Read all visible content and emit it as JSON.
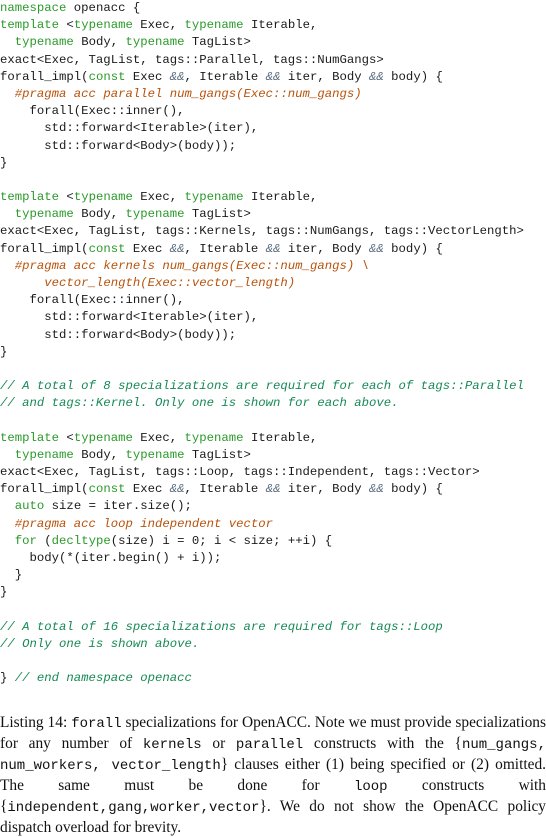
{
  "listing": {
    "lines": [
      [
        [
          "kw",
          "namespace"
        ],
        [
          "tx",
          " openacc {"
        ]
      ],
      [
        [
          "kw",
          "template"
        ],
        [
          "tx",
          " <"
        ],
        [
          "kw",
          "typename"
        ],
        [
          "tx",
          " Exec, "
        ],
        [
          "kw",
          "typename"
        ],
        [
          "tx",
          " Iterable,"
        ]
      ],
      [
        [
          "tx",
          "  "
        ],
        [
          "kw",
          "typename"
        ],
        [
          "tx",
          " Body, "
        ],
        [
          "kw",
          "typename"
        ],
        [
          "tx",
          " TagList>"
        ]
      ],
      [
        [
          "tx",
          "exact<Exec, TagList, tags::Parallel, tags::NumGangs>"
        ]
      ],
      [
        [
          "tx",
          "forall_impl("
        ],
        [
          "kw",
          "const"
        ],
        [
          "tx",
          " Exec "
        ],
        [
          "op",
          "&&"
        ],
        [
          "tx",
          ", Iterable "
        ],
        [
          "op",
          "&&"
        ],
        [
          "tx",
          " iter, Body "
        ],
        [
          "op",
          "&&"
        ],
        [
          "tx",
          " body) {"
        ]
      ],
      [
        [
          "tx",
          "  "
        ],
        [
          "pp",
          "#pragma acc parallel num_gangs(Exec::num_gangs)"
        ]
      ],
      [
        [
          "tx",
          "    forall(Exec::inner(),"
        ]
      ],
      [
        [
          "tx",
          "      std::forward<Iterable>(iter),"
        ]
      ],
      [
        [
          "tx",
          "      std::forward<Body>(body));"
        ]
      ],
      [
        [
          "tx",
          "}"
        ]
      ],
      [],
      [
        [
          "kw",
          "template"
        ],
        [
          "tx",
          " <"
        ],
        [
          "kw",
          "typename"
        ],
        [
          "tx",
          " Exec, "
        ],
        [
          "kw",
          "typename"
        ],
        [
          "tx",
          " Iterable,"
        ]
      ],
      [
        [
          "tx",
          "  "
        ],
        [
          "kw",
          "typename"
        ],
        [
          "tx",
          " Body, "
        ],
        [
          "kw",
          "typename"
        ],
        [
          "tx",
          " TagList>"
        ]
      ],
      [
        [
          "tx",
          "exact<Exec, TagList, tags::Kernels, tags::NumGangs, tags::VectorLength>"
        ]
      ],
      [
        [
          "tx",
          "forall_impl("
        ],
        [
          "kw",
          "const"
        ],
        [
          "tx",
          " Exec "
        ],
        [
          "op",
          "&&"
        ],
        [
          "tx",
          ", Iterable "
        ],
        [
          "op",
          "&&"
        ],
        [
          "tx",
          " iter, Body "
        ],
        [
          "op",
          "&&"
        ],
        [
          "tx",
          " body) {"
        ]
      ],
      [
        [
          "tx",
          "  "
        ],
        [
          "pp",
          "#pragma acc kernels num_gangs(Exec::num_gangs) \\"
        ]
      ],
      [
        [
          "tx",
          "      "
        ],
        [
          "pp",
          "vector_length(Exec::vector_length)"
        ]
      ],
      [
        [
          "tx",
          "    forall(Exec::inner(),"
        ]
      ],
      [
        [
          "tx",
          "      std::forward<Iterable>(iter),"
        ]
      ],
      [
        [
          "tx",
          "      std::forward<Body>(body));"
        ]
      ],
      [
        [
          "tx",
          "}"
        ]
      ],
      [],
      [
        [
          "cm",
          "// A total of 8 specializations are required for each of tags::Parallel"
        ]
      ],
      [
        [
          "cm",
          "// and tags::Kernel. Only one is shown for each above."
        ]
      ],
      [],
      [
        [
          "kw",
          "template"
        ],
        [
          "tx",
          " <"
        ],
        [
          "kw",
          "typename"
        ],
        [
          "tx",
          " Exec, "
        ],
        [
          "kw",
          "typename"
        ],
        [
          "tx",
          " Iterable,"
        ]
      ],
      [
        [
          "tx",
          "  "
        ],
        [
          "kw",
          "typename"
        ],
        [
          "tx",
          " Body, "
        ],
        [
          "kw",
          "typename"
        ],
        [
          "tx",
          " TagList>"
        ]
      ],
      [
        [
          "tx",
          "exact<Exec, TagList, tags::Loop, tags::Independent, tags::Vector>"
        ]
      ],
      [
        [
          "tx",
          "forall_impl("
        ],
        [
          "kw",
          "const"
        ],
        [
          "tx",
          " Exec "
        ],
        [
          "op",
          "&&"
        ],
        [
          "tx",
          ", Iterable "
        ],
        [
          "op",
          "&&"
        ],
        [
          "tx",
          " iter, Body "
        ],
        [
          "op",
          "&&"
        ],
        [
          "tx",
          " body) {"
        ]
      ],
      [
        [
          "tx",
          "  "
        ],
        [
          "kw",
          "auto"
        ],
        [
          "tx",
          " size = iter.size();"
        ]
      ],
      [
        [
          "tx",
          "  "
        ],
        [
          "pp",
          "#pragma acc loop independent vector"
        ]
      ],
      [
        [
          "tx",
          "  "
        ],
        [
          "kw",
          "for"
        ],
        [
          "tx",
          " ("
        ],
        [
          "kw",
          "decltype"
        ],
        [
          "tx",
          "(size) i = 0; i < size; ++i) {"
        ]
      ],
      [
        [
          "tx",
          "    body(*(iter.begin() + i));"
        ]
      ],
      [
        [
          "tx",
          "  }"
        ]
      ],
      [
        [
          "tx",
          "}"
        ]
      ],
      [],
      [
        [
          "cm",
          "// A total of 16 specializations are required for tags::Loop"
        ]
      ],
      [
        [
          "cm",
          "// Only one is shown above."
        ]
      ],
      [],
      [
        [
          "tx",
          "} "
        ],
        [
          "cm",
          "// end namespace openacc"
        ]
      ]
    ]
  },
  "caption": {
    "label": "Listing 14:",
    "parts": [
      [
        "mono",
        "forall"
      ],
      [
        "text",
        " specializations for OpenACC. Note we must provide specializations for any number of "
      ],
      [
        "mono",
        "kernels"
      ],
      [
        "text",
        " or "
      ],
      [
        "mono",
        "parallel"
      ],
      [
        "text",
        " constructs with the {"
      ],
      [
        "mono",
        "num_gangs, num_workers, vector_length"
      ],
      [
        "text",
        "} clauses either (1) being specified or (2) omitted. The same must be done for "
      ],
      [
        "mono",
        "loop"
      ],
      [
        "text",
        " constructs with {"
      ],
      [
        "mono",
        "independent,gang,worker,vector"
      ],
      [
        "text",
        "}. We do not show the OpenACC policy dispatch overload for brevity."
      ]
    ]
  },
  "colors": {
    "keyword": "#2a9a2a",
    "pragma": "#b8520b",
    "comment": "#168a55",
    "operator": "#5c6e80",
    "text": "#1a1a1a"
  }
}
